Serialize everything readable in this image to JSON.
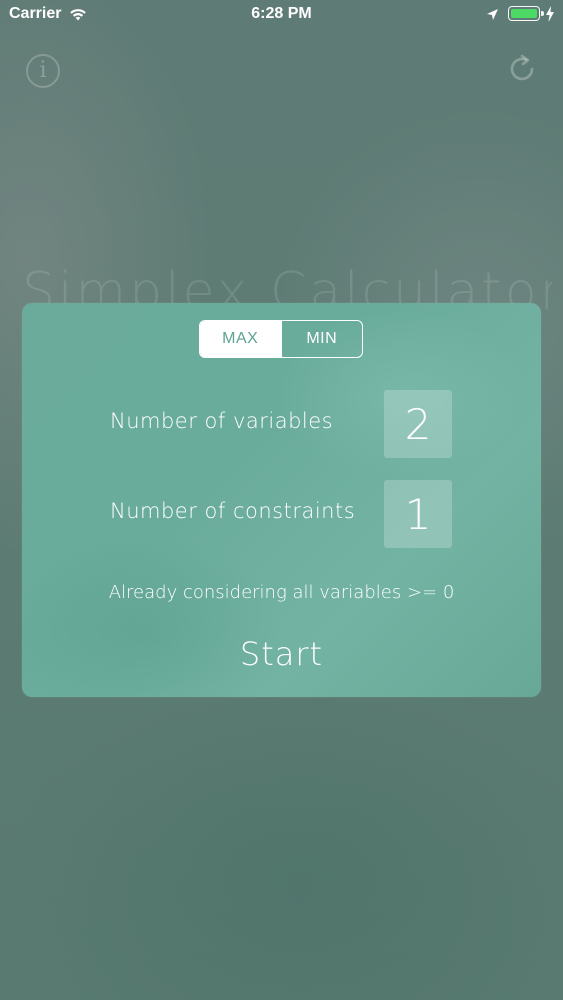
{
  "status_bar": {
    "carrier": "Carrier",
    "time": "6:28 PM",
    "battery_level": 1.0,
    "battery_color": "#4cd964",
    "icons": [
      "wifi-icon",
      "location-arrow-icon",
      "battery-icon",
      "charging-bolt-icon"
    ]
  },
  "toolbar": {
    "info_icon": "info-icon",
    "info_glyph": "i",
    "refresh_icon": "refresh-icon"
  },
  "background_title": "Simplex Calculator",
  "card": {
    "mode_options": [
      "MAX",
      "MIN"
    ],
    "selected_mode": "MAX",
    "variables_label": "Number of variables",
    "variables_value": "2",
    "constraints_label": "Number of constraints",
    "constraints_value": "1",
    "note": "Already considering all variables >= 0",
    "start_label": "Start"
  },
  "colors": {
    "background": "#5c7a73",
    "card": "#6aab9b",
    "accent_text": "#5ea292"
  }
}
